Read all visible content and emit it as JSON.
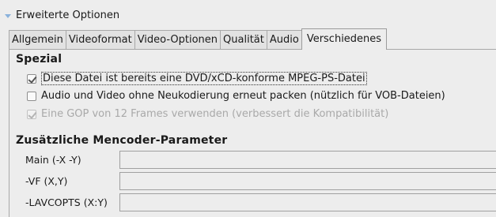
{
  "expander": {
    "label": "Erweiterte Optionen",
    "icon": "expander-triangle-icon"
  },
  "tabs": [
    {
      "label": "Allgemein",
      "active": false
    },
    {
      "label": "Videoformat",
      "active": false
    },
    {
      "label": "Video-Optionen",
      "active": false
    },
    {
      "label": "Qualität",
      "active": false
    },
    {
      "label": "Audio",
      "active": false
    },
    {
      "label": "Verschiedenes",
      "active": true
    }
  ],
  "spezial": {
    "title": "Spezial",
    "options": [
      {
        "label": "Diese Datei ist bereits eine DVD/xCD-konforme MPEG-PS-Datei",
        "checked": true,
        "disabled": false,
        "focused": true
      },
      {
        "label": "Audio und Video ohne Neukodierung erneut packen (nützlich für VOB-Dateien)",
        "checked": false,
        "disabled": false,
        "focused": false
      },
      {
        "label": "Eine GOP von 12 Frames verwenden (verbessert die Kompatibilität)",
        "checked": true,
        "disabled": true,
        "focused": false
      }
    ]
  },
  "mencoder": {
    "title": "Zusätzliche Mencoder-Parameter",
    "params": [
      {
        "label": "Main (-X -Y)",
        "value": ""
      },
      {
        "label": "-VF (X,Y)",
        "value": ""
      },
      {
        "label": "-LAVCOPTS (X:Y)",
        "value": ""
      }
    ]
  },
  "colors": {
    "expander_arrow": "#8ab2dc",
    "background": "#ededed",
    "disabled_text": "#a9a9a9"
  }
}
